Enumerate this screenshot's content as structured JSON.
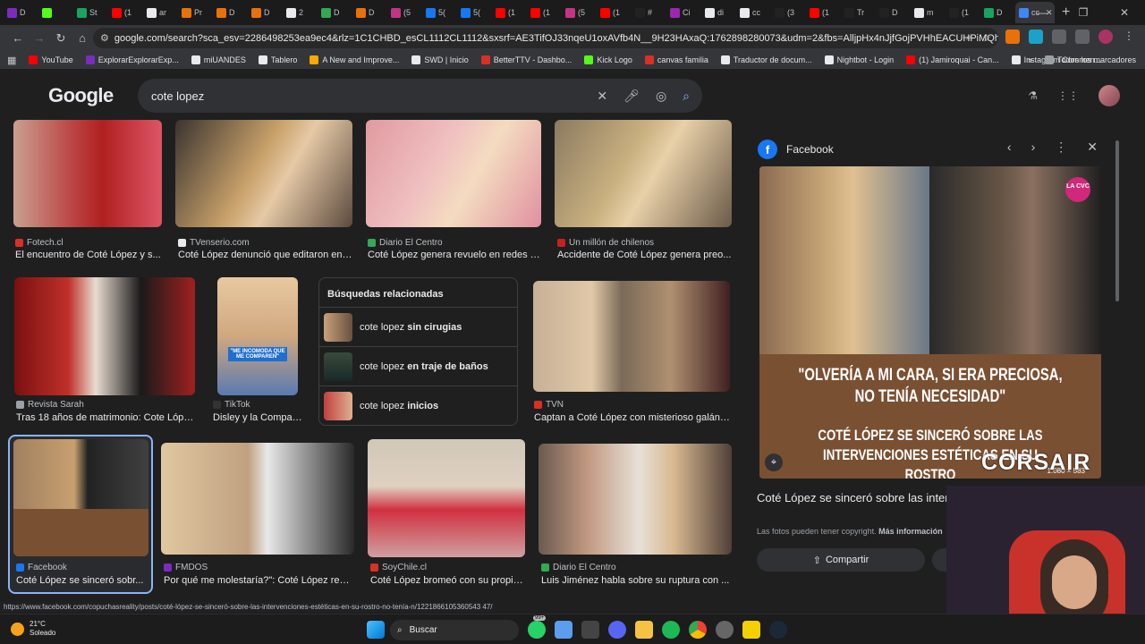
{
  "browser": {
    "tabs": [
      {
        "label": "D",
        "color": "#7b2cbf"
      },
      {
        "label": "",
        "color": "#53fc18"
      },
      {
        "label": "St",
        "color": "#1aa260"
      },
      {
        "label": "(1",
        "color": "#ff0000"
      },
      {
        "label": "ar",
        "color": "#e8eaed"
      },
      {
        "label": "Pr",
        "color": "#e8710a"
      },
      {
        "label": "D",
        "color": "#e8710a"
      },
      {
        "label": "D",
        "color": "#e8710a"
      },
      {
        "label": "2",
        "color": "#e8eaed"
      },
      {
        "label": "D",
        "color": "#34a853"
      },
      {
        "label": "D",
        "color": "#e8710a"
      },
      {
        "label": "(5",
        "color": "#c13584"
      },
      {
        "label": "5(",
        "color": "#1877f2"
      },
      {
        "label": "5(",
        "color": "#1877f2"
      },
      {
        "label": "(1",
        "color": "#ff0000"
      },
      {
        "label": "(1",
        "color": "#ff0000"
      },
      {
        "label": "(5",
        "color": "#c13584"
      },
      {
        "label": "(1",
        "color": "#ff0000"
      },
      {
        "label": "#",
        "color": "#222222"
      },
      {
        "label": "Ci",
        "color": "#9c27b0"
      },
      {
        "label": "di",
        "color": "#e8eaed"
      },
      {
        "label": "cc",
        "color": "#e8eaed"
      },
      {
        "label": "(3",
        "color": "#222222"
      },
      {
        "label": "(1",
        "color": "#ff0000"
      },
      {
        "label": "Tr",
        "color": "#222222"
      },
      {
        "label": "D",
        "color": "#222222"
      },
      {
        "label": "m",
        "color": "#e8eaed"
      },
      {
        "label": "(1",
        "color": "#222222"
      },
      {
        "label": "D",
        "color": "#1aa260"
      }
    ],
    "active_tab": {
      "label": "cc",
      "color": "#4285f4"
    },
    "url": "google.com/search?sca_esv=2286498253ea9ec4&rlz=1C1CHBD_esCL1112CL1112&sxsrf=AE3TifOJ33nqeU1oxAVfb4N__9H23HAxaQ:1762898280073&udm=2&fbs=AlljpHx4nJjfGojPVHhEACUHPiMQht6_BFq6vBIoFFRK7qchKHD...",
    "bookmarks": [
      {
        "label": "YouTube",
        "color": "#ff0000"
      },
      {
        "label": "ExplorarExplorarExp...",
        "color": "#7b2cbf"
      },
      {
        "label": "miUANDES",
        "color": "#e8eaed"
      },
      {
        "label": "Tablero",
        "color": "#e8eaed"
      },
      {
        "label": "A New and Improve...",
        "color": "#f9ab00"
      },
      {
        "label": "SWD | Inicio",
        "color": "#e8eaed"
      },
      {
        "label": "BetterTTV - Dashbo...",
        "color": "#d93025"
      },
      {
        "label": "Kick Logo",
        "color": "#53fc18"
      },
      {
        "label": "canvas familia",
        "color": "#d93025"
      },
      {
        "label": "Traductor de docum...",
        "color": "#e8eaed"
      },
      {
        "label": "Nightbot - Login",
        "color": "#e8eaed"
      },
      {
        "label": "(1) Jamiroquai - Can...",
        "color": "#ff0000"
      },
      {
        "label": "Instagram Commen...",
        "color": "#e8eaed"
      }
    ],
    "bookmarks_more": "»",
    "all_bookmarks": "Todos los marcadores"
  },
  "google": {
    "logo": "Google",
    "query": "cote lopez"
  },
  "results": [
    {
      "source": "Fotech.cl",
      "title": "El encuentro de Coté López y s...",
      "color": "#d93025"
    },
    {
      "source": "TVenserio.com",
      "title": "Coté López denunció que editaron ent...",
      "color": "#e8eaed"
    },
    {
      "source": "Diario El Centro",
      "title": "Coté López genera revuelo en redes s...",
      "color": "#34a853"
    },
    {
      "source": "Un millón de chilenos",
      "title": "Accidente de Coté López genera preo...",
      "color": "#c5221f"
    },
    {
      "source": "Revista Sarah",
      "title": "Tras 18 años de matrimonio: Cote Lópe...",
      "color": "#9aa0a6"
    },
    {
      "source": "TikTok",
      "title": "Disley y la Compar...",
      "color": "#222222"
    },
    {
      "source": "TVN",
      "title": "Captan a Coté López con misterioso galán ...",
      "color": "#d93025"
    },
    {
      "source": "Facebook",
      "title": "Coté López se sinceró sobr...",
      "color": "#1877f2"
    },
    {
      "source": "FMDOS",
      "title": "Por qué me molestaría?\": Coté López resp...",
      "color": "#7b2cbf"
    },
    {
      "source": "SoyChile.cl",
      "title": "Coté López bromeó con su propia...",
      "color": "#d93025"
    },
    {
      "source": "Diario El Centro",
      "title": "Luis Jiménez habla sobre su ruptura con ...",
      "color": "#34a853"
    }
  ],
  "related": {
    "heading": "Búsquedas relacionadas",
    "items": [
      {
        "prefix": "cote lopez",
        "bold": "sin cirugias"
      },
      {
        "prefix": "cote lopez",
        "bold": "en traje de baños"
      },
      {
        "prefix": "cote lopez",
        "bold": "inicios"
      }
    ]
  },
  "tiktok_caption": "\"ME INCOMODA QUE ME COMPAREN\"",
  "panel": {
    "source": "Facebook",
    "image_quote": "\"OLVERÍA A MI CARA, SI ERA PRECIOSA, NO TENÍA NECESIDAD\"",
    "image_headline": "COTÉ LÓPEZ SE SINCERÓ SOBRE LAS INTERVENCIONES ESTÉTICAS EN SU ROSTRO",
    "badge": "LA CVC",
    "dimensions": "1.080 × 583",
    "watermark": "CORSAIR",
    "title": "Coté López se sinceró sobre las intervenciones estéticas en su rostro: \"No tenía necesidad\"",
    "copyright": "Las fotos pueden tener copyright.",
    "more_info": "Más información",
    "share": "Compartir"
  },
  "status_url": "https://www.facebook.com/copuchasreality/posts/coté-lópez-se-sinceró-sobre-las-intervenciones-estéticas-en-su-rostro-no-tenía-n/1221866105360543 47/",
  "taskbar": {
    "temp": "21°C",
    "weather": "Soleado",
    "search": "Buscar",
    "badge": "99+"
  }
}
